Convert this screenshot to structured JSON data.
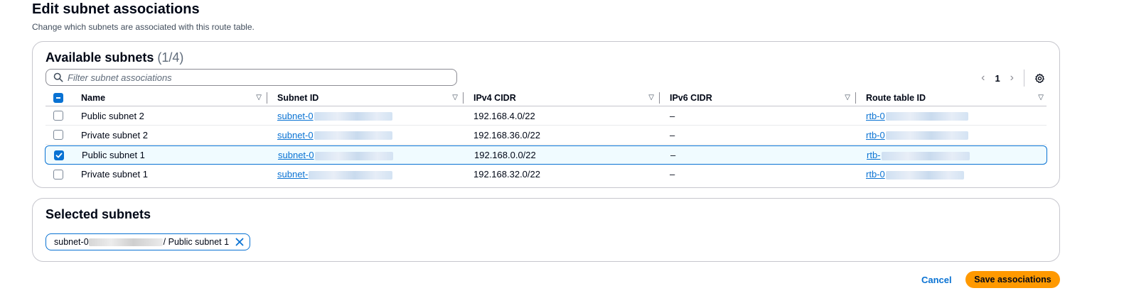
{
  "page": {
    "title": "Edit subnet associations",
    "description": "Change which subnets are associated with this route table."
  },
  "available": {
    "title": "Available subnets",
    "count": "(1/4)",
    "filter_placeholder": "Filter subnet associations",
    "page_number": "1",
    "columns": [
      "Name",
      "Subnet ID",
      "IPv4 CIDR",
      "IPv6 CIDR",
      "Route table ID"
    ],
    "rows": [
      {
        "checked": false,
        "name": "Public subnet 2",
        "subnet_id": "subnet-0",
        "ipv4": "192.168.4.0/22",
        "ipv6": "–",
        "route_table": "rtb-0"
      },
      {
        "checked": false,
        "name": "Private subnet 2",
        "subnet_id": "subnet-0",
        "ipv4": "192.168.36.0/22",
        "ipv6": "–",
        "route_table": "rtb-0"
      },
      {
        "checked": true,
        "name": "Public subnet 1",
        "subnet_id": "subnet-0",
        "ipv4": "192.168.0.0/22",
        "ipv6": "–",
        "route_table": "rtb-"
      },
      {
        "checked": false,
        "name": "Private subnet 1",
        "subnet_id": "subnet-",
        "ipv4": "192.168.32.0/22",
        "ipv6": "–",
        "route_table": "rtb-0"
      }
    ]
  },
  "selected": {
    "title": "Selected subnets",
    "token_prefix": "subnet-0",
    "token_suffix": "/ Public subnet 1"
  },
  "actions": {
    "cancel": "Cancel",
    "save": "Save associations"
  },
  "colors": {
    "accent": "#0972d3",
    "primary_button": "#ff9900",
    "text": "#000716",
    "selected_row_bg": "#f0fbff"
  },
  "icons": {
    "filter": "search-icon",
    "settings": "gear-icon",
    "sort": "sort-down-icon",
    "token_remove": "close-icon"
  }
}
